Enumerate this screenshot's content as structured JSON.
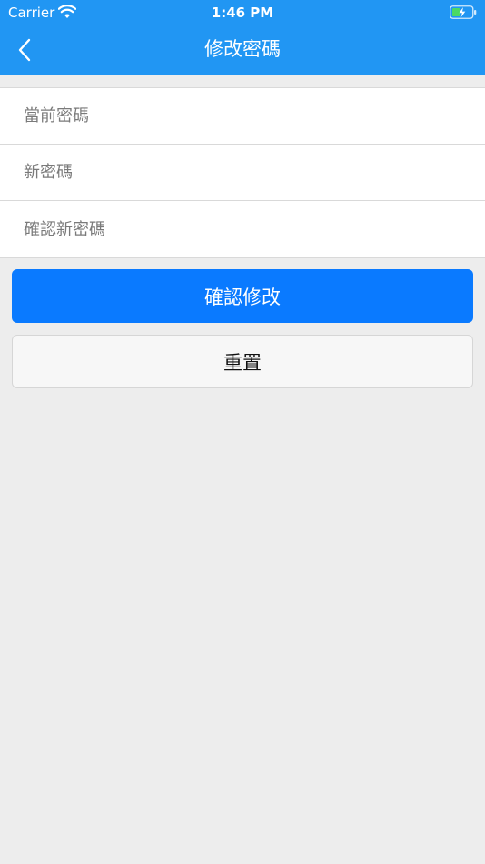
{
  "status_bar": {
    "carrier": "Carrier",
    "time": "1:46 PM",
    "icons": [
      "wifi-icon",
      "battery-charging-icon"
    ]
  },
  "header": {
    "title": "修改密碼",
    "back_icon": "chevron-left-icon",
    "background": "#2196f3"
  },
  "form": {
    "current_password": {
      "placeholder": "當前密碼",
      "value": ""
    },
    "new_password": {
      "placeholder": "新密碼",
      "value": ""
    },
    "confirm_password": {
      "placeholder": "確認新密碼",
      "value": ""
    }
  },
  "actions": {
    "confirm_label": "確認修改",
    "confirm_color": "#0a7aff",
    "reset_label": "重置"
  }
}
